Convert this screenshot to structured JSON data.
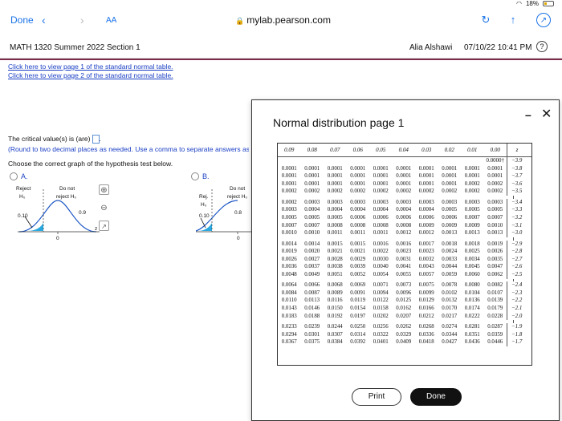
{
  "status_bar": {
    "battery": "18%"
  },
  "toolbar": {
    "done_label": "Done",
    "aa_label": "AA",
    "url": "mylab.pearson.com"
  },
  "header": {
    "course": "MATH 1320 Summer 2022 Section 1",
    "user": "Alia Alshawi",
    "datetime": "07/10/22 10:41 PM",
    "help": "?"
  },
  "links": [
    "Click here to view page 1 of the standard normal table.",
    "Click here to view page 2 of the standard normal table."
  ],
  "question": {
    "critical_prompt": "The critical value(s) is (are)",
    "hint": "(Round to two decimal places as needed. Use a comma to separate answers as",
    "choose": "Choose the correct graph of the hypothesis test below."
  },
  "options": {
    "a": {
      "label": "A.",
      "reject": "Reject",
      "h0": "H₀",
      "do_not": "Do not",
      "reject_h0": "reject H₀",
      "area_left": "0.10",
      "area_mid": "0.9",
      "zero": "0",
      "z": "z"
    },
    "b": {
      "label": "B.",
      "rej": "Rej.",
      "h0": "H₀",
      "do_not": "Do not",
      "reject_h0": "reject H₀",
      "area_left": "0.10",
      "area_mid": "0.8",
      "zero": "0"
    }
  },
  "modal": {
    "title": "Normal distribution page 1",
    "print_label": "Print",
    "done_label": "Done",
    "columns": [
      "0.09",
      "0.08",
      "0.07",
      "0.06",
      "0.05",
      "0.04",
      "0.03",
      "0.02",
      "0.01",
      "0.00"
    ],
    "z_header": "z",
    "top_value": "0.0000†",
    "groups": [
      [
        {
          "z": "−3.9",
          "vals": [
            "",
            "",
            "",
            "",
            "",
            "",
            "",
            "",
            "",
            ""
          ]
        },
        {
          "z": "−3.8",
          "vals": [
            "0.0001",
            "0.0001",
            "0.0001",
            "0.0001",
            "0.0001",
            "0.0001",
            "0.0001",
            "0.0001",
            "0.0001",
            "0.0001"
          ]
        },
        {
          "z": "−3.7",
          "vals": [
            "0.0001",
            "0.0001",
            "0.0001",
            "0.0001",
            "0.0001",
            "0.0001",
            "0.0001",
            "0.0001",
            "0.0001",
            "0.0001"
          ]
        },
        {
          "z": "−3.6",
          "vals": [
            "0.0001",
            "0.0001",
            "0.0001",
            "0.0001",
            "0.0001",
            "0.0001",
            "0.0001",
            "0.0001",
            "0.0002",
            "0.0002"
          ]
        },
        {
          "z": "−3.5",
          "vals": [
            "0.0002",
            "0.0002",
            "0.0002",
            "0.0002",
            "0.0002",
            "0.0002",
            "0.0002",
            "0.0002",
            "0.0002",
            "0.0002"
          ]
        }
      ],
      [
        {
          "z": "−3.4",
          "vals": [
            "0.0002",
            "0.0003",
            "0.0003",
            "0.0003",
            "0.0003",
            "0.0003",
            "0.0003",
            "0.0003",
            "0.0003",
            "0.0003"
          ]
        },
        {
          "z": "−3.3",
          "vals": [
            "0.0003",
            "0.0004",
            "0.0004",
            "0.0004",
            "0.0004",
            "0.0004",
            "0.0004",
            "0.0005",
            "0.0005",
            "0.0005"
          ]
        },
        {
          "z": "−3.2",
          "vals": [
            "0.0005",
            "0.0005",
            "0.0005",
            "0.0006",
            "0.0006",
            "0.0006",
            "0.0006",
            "0.0006",
            "0.0007",
            "0.0007"
          ]
        },
        {
          "z": "−3.1",
          "vals": [
            "0.0007",
            "0.0007",
            "0.0008",
            "0.0008",
            "0.0008",
            "0.0008",
            "0.0009",
            "0.0009",
            "0.0009",
            "0.0010"
          ]
        },
        {
          "z": "−3.0",
          "vals": [
            "0.0010",
            "0.0010",
            "0.0011",
            "0.0011",
            "0.0011",
            "0.0012",
            "0.0012",
            "0.0013",
            "0.0013",
            "0.0013"
          ]
        }
      ],
      [
        {
          "z": "−2.9",
          "vals": [
            "0.0014",
            "0.0014",
            "0.0015",
            "0.0015",
            "0.0016",
            "0.0016",
            "0.0017",
            "0.0018",
            "0.0018",
            "0.0019"
          ]
        },
        {
          "z": "−2.8",
          "vals": [
            "0.0019",
            "0.0020",
            "0.0021",
            "0.0021",
            "0.0022",
            "0.0023",
            "0.0023",
            "0.0024",
            "0.0025",
            "0.0026"
          ]
        },
        {
          "z": "−2.7",
          "vals": [
            "0.0026",
            "0.0027",
            "0.0028",
            "0.0029",
            "0.0030",
            "0.0031",
            "0.0032",
            "0.0033",
            "0.0034",
            "0.0035"
          ]
        },
        {
          "z": "−2.6",
          "vals": [
            "0.0036",
            "0.0037",
            "0.0038",
            "0.0039",
            "0.0040",
            "0.0041",
            "0.0043",
            "0.0044",
            "0.0045",
            "0.0047"
          ]
        },
        {
          "z": "−2.5",
          "vals": [
            "0.0048",
            "0.0049",
            "0.0051",
            "0.0052",
            "0.0054",
            "0.0055",
            "0.0057",
            "0.0059",
            "0.0060",
            "0.0062"
          ]
        }
      ],
      [
        {
          "z": "−2.4",
          "vals": [
            "0.0064",
            "0.0066",
            "0.0068",
            "0.0069",
            "0.0071",
            "0.0073",
            "0.0075",
            "0.0078",
            "0.0080",
            "0.0082"
          ]
        },
        {
          "z": "−2.3",
          "vals": [
            "0.0084",
            "0.0087",
            "0.0089",
            "0.0091",
            "0.0094",
            "0.0096",
            "0.0099",
            "0.0102",
            "0.0104",
            "0.0107"
          ]
        },
        {
          "z": "−2.2",
          "vals": [
            "0.0110",
            "0.0113",
            "0.0116",
            "0.0119",
            "0.0122",
            "0.0125",
            "0.0129",
            "0.0132",
            "0.0136",
            "0.0139"
          ]
        },
        {
          "z": "−2.1",
          "vals": [
            "0.0143",
            "0.0146",
            "0.0150",
            "0.0154",
            "0.0158",
            "0.0162",
            "0.0166",
            "0.0170",
            "0.0174",
            "0.0179"
          ]
        },
        {
          "z": "−2.0",
          "vals": [
            "0.0183",
            "0.0188",
            "0.0192",
            "0.0197",
            "0.0202",
            "0.0207",
            "0.0212",
            "0.0217",
            "0.0222",
            "0.0228"
          ]
        }
      ],
      [
        {
          "z": "−1.9",
          "vals": [
            "0.0233",
            "0.0239",
            "0.0244",
            "0.0250",
            "0.0256",
            "0.0262",
            "0.0268",
            "0.0274",
            "0.0281",
            "0.0287"
          ]
        },
        {
          "z": "−1.8",
          "vals": [
            "0.0294",
            "0.0301",
            "0.0307",
            "0.0314",
            "0.0322",
            "0.0329",
            "0.0336",
            "0.0344",
            "0.0351",
            "0.0359"
          ]
        },
        {
          "z": "−1.7",
          "vals": [
            "0.0367",
            "0.0375",
            "0.0384",
            "0.0392",
            "0.0401",
            "0.0409",
            "0.0418",
            "0.0427",
            "0.0436",
            "0.0446"
          ]
        }
      ]
    ]
  }
}
